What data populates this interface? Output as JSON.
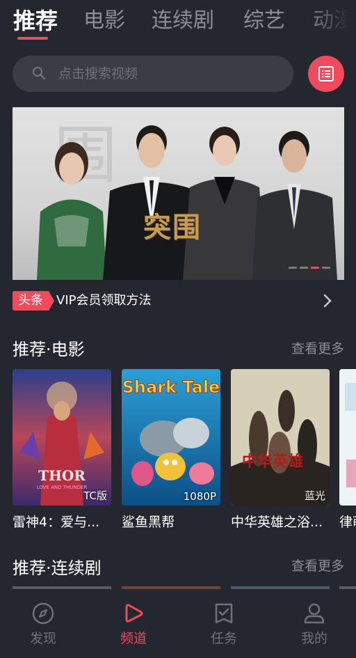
{
  "tabs": [
    "推荐",
    "电影",
    "连续剧",
    "综艺",
    "动漫"
  ],
  "active_tab": "推荐",
  "search": {
    "placeholder": "点击搜索视频"
  },
  "banner": {
    "title": "突围",
    "slides": 4,
    "active_slide": 3
  },
  "news": {
    "tag": "头条",
    "text": "VIP会员领取方法"
  },
  "sections": [
    {
      "title": "推荐·电影",
      "more": "查看更多",
      "items": [
        {
          "title": "雷神4：爱与...",
          "badge": "TC版"
        },
        {
          "title": "鲨鱼黑帮",
          "badge": "1080P"
        },
        {
          "title": "中华英雄之浴...",
          "badge": "蓝光"
        },
        {
          "title": "律萌...",
          "badge": ""
        }
      ]
    },
    {
      "title": "推荐·连续剧",
      "more": "查看更多"
    }
  ],
  "bottom_nav": [
    {
      "label": "发现",
      "icon": "compass-icon",
      "active": false
    },
    {
      "label": "频道",
      "icon": "play-icon",
      "active": true
    },
    {
      "label": "任务",
      "icon": "task-icon",
      "active": false
    },
    {
      "label": "我的",
      "icon": "user-icon",
      "active": false
    }
  ],
  "colors": {
    "accent": "#f2495d",
    "background": "#24272f",
    "muted": "#8b8e95"
  }
}
